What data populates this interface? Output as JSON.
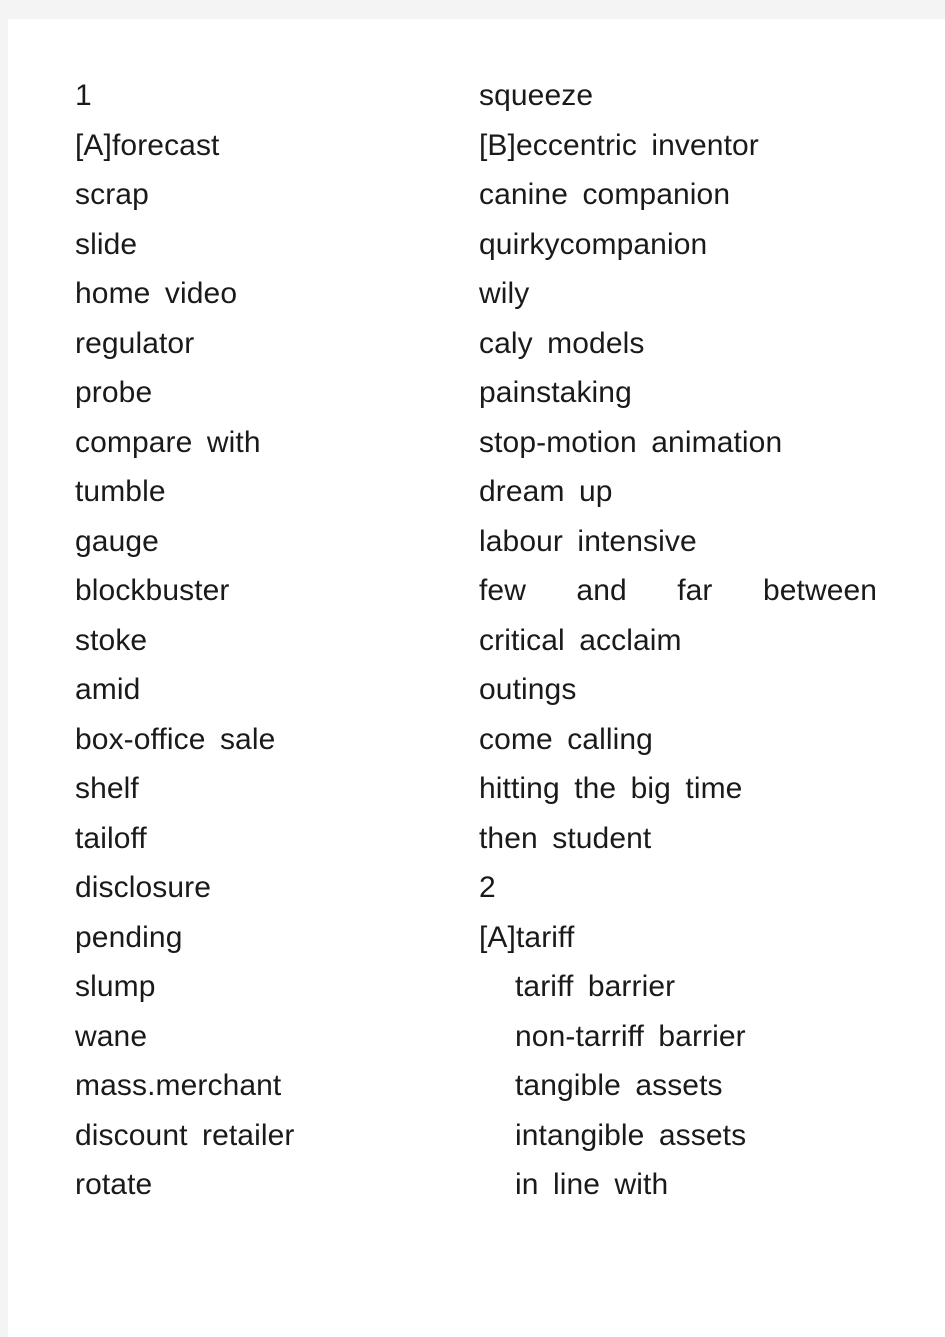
{
  "document": {
    "page_background": "#ffffff",
    "surround_background": "#f4f4f4",
    "text_color": "#1a1a1a",
    "left_column": [
      {
        "text": "1",
        "style": "plain"
      },
      {
        "text": "[A]forecast",
        "style": "plain"
      },
      {
        "text": "scrap",
        "style": "plain"
      },
      {
        "text": "slide",
        "style": "plain"
      },
      {
        "text": "home video",
        "style": "gap"
      },
      {
        "text": "regulator",
        "style": "plain"
      },
      {
        "text": "probe",
        "style": "plain"
      },
      {
        "text": "compare with",
        "style": "gap"
      },
      {
        "text": "tumble",
        "style": "plain"
      },
      {
        "text": "gauge",
        "style": "plain"
      },
      {
        "text": "blockbuster",
        "style": "plain"
      },
      {
        "text": "stoke",
        "style": "plain"
      },
      {
        "text": "amid",
        "style": "plain"
      },
      {
        "text": "box-office sale",
        "style": "gap"
      },
      {
        "text": "shelf",
        "style": "plain"
      },
      {
        "text": "tailoff",
        "style": "plain"
      },
      {
        "text": "disclosure",
        "style": "plain"
      },
      {
        "text": "pending",
        "style": "plain"
      },
      {
        "text": "slump",
        "style": "plain"
      },
      {
        "text": "wane",
        "style": "plain"
      },
      {
        "text": "mass.merchant",
        "style": "plain"
      },
      {
        "text": "discount retailer",
        "style": "gap"
      },
      {
        "text": "rotate",
        "style": "plain"
      }
    ],
    "right_column": [
      {
        "text": "squeeze",
        "style": "plain"
      },
      {
        "text": "[B]eccentric inventor",
        "style": "gap"
      },
      {
        "text": "canine companion",
        "style": "gap"
      },
      {
        "text": "quirkycompanion",
        "style": "plain"
      },
      {
        "text": "wily",
        "style": "plain"
      },
      {
        "text": "caly models",
        "style": "gap"
      },
      {
        "text": "painstaking",
        "style": "plain"
      },
      {
        "text": "stop-motion animation",
        "style": "gap"
      },
      {
        "text": "dream up",
        "style": "gap"
      },
      {
        "text": "labour intensive",
        "style": "gap"
      },
      {
        "text": "few and far between",
        "style": "wide"
      },
      {
        "text": "critical acclaim",
        "style": "gap"
      },
      {
        "text": "outings",
        "style": "plain"
      },
      {
        "text": "come calling",
        "style": "gap"
      },
      {
        "text": "hitting the big time",
        "style": "gap"
      },
      {
        "text": "then student",
        "style": "gap"
      },
      {
        "text": "2",
        "style": "plain"
      },
      {
        "text": "[A]tariff",
        "style": "plain"
      },
      {
        "text": "tariff barrier",
        "style": "indent gap"
      },
      {
        "text": "non-tarriff barrier",
        "style": "indent gap"
      },
      {
        "text": "tangible assets",
        "style": "indent gap"
      },
      {
        "text": "intangible assets",
        "style": "indent gap"
      },
      {
        "text": "in line with",
        "style": "indent gap"
      }
    ]
  }
}
